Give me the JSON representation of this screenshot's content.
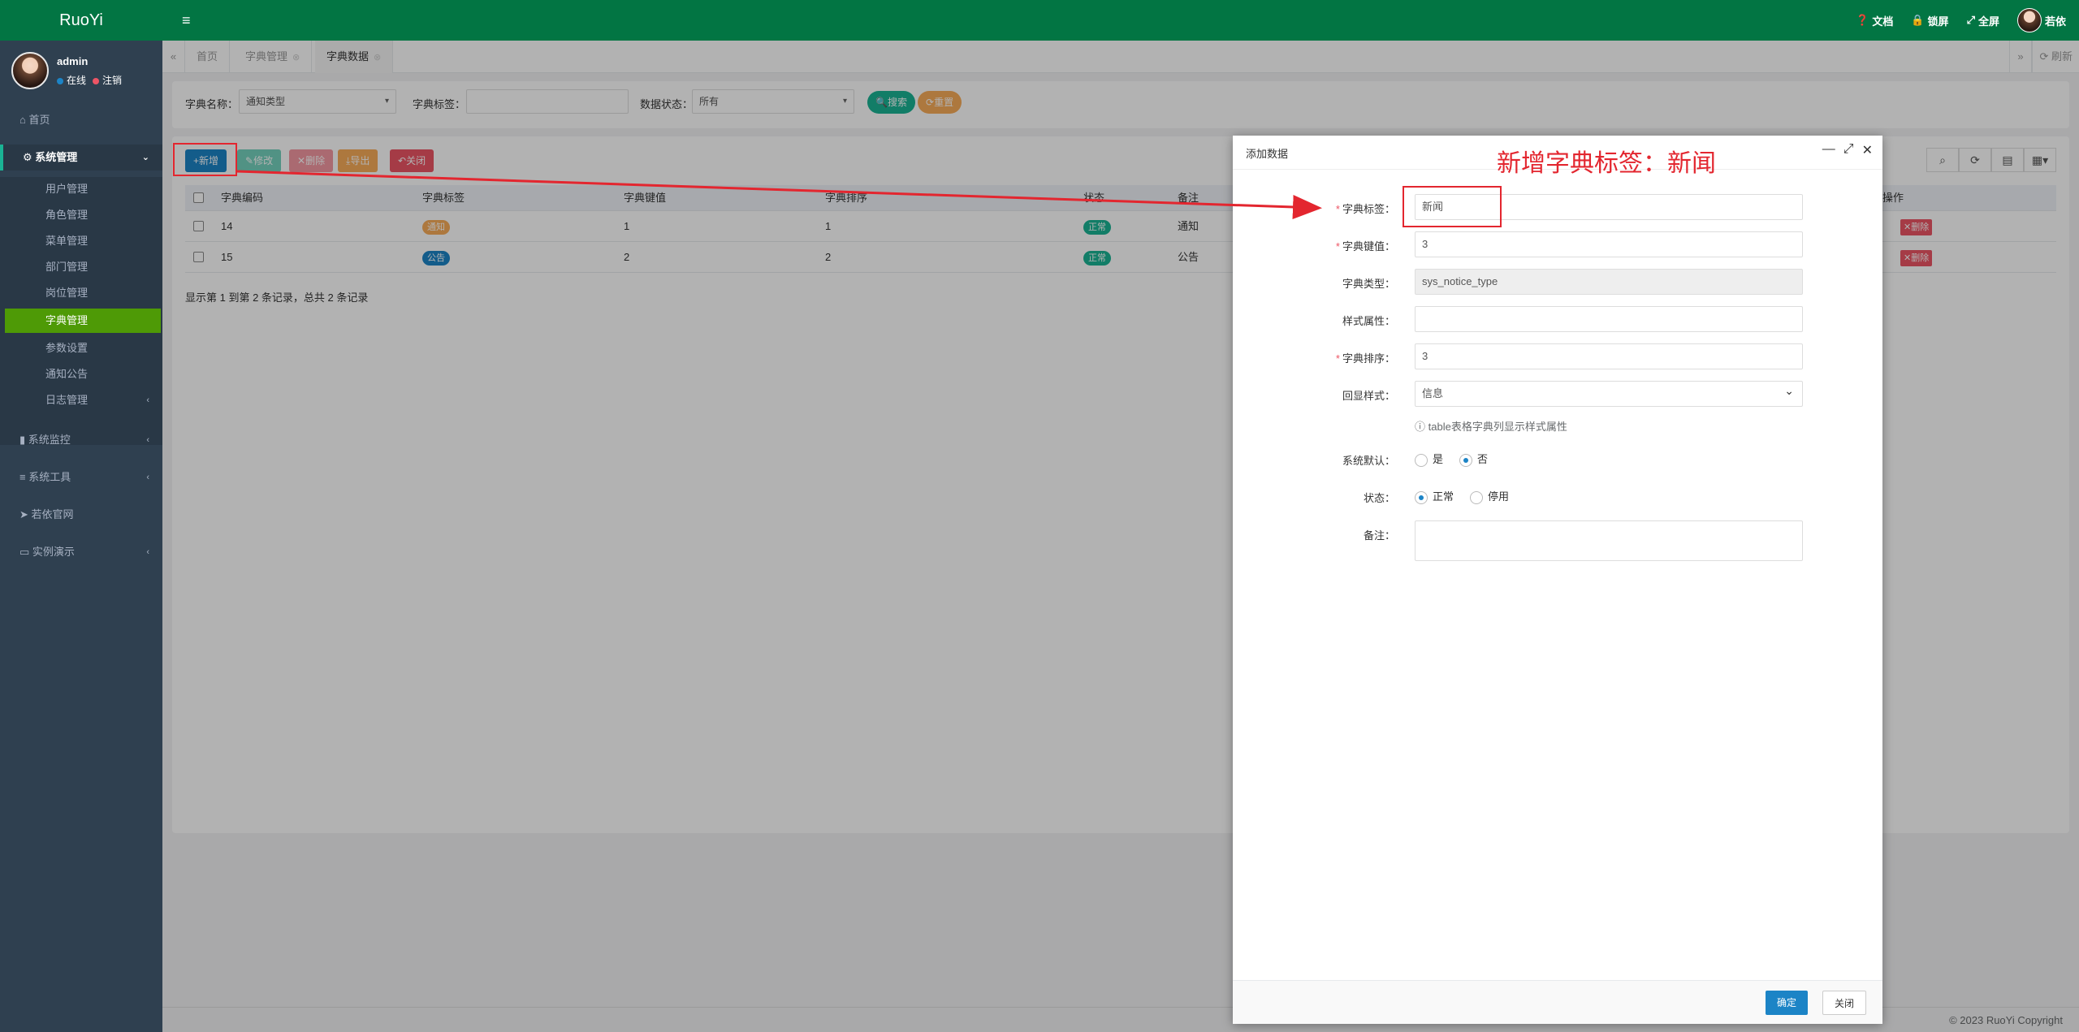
{
  "app": {
    "logo": "RuoYi"
  },
  "topbar": {
    "menu_icon": "bars-icon",
    "links": [
      {
        "icon": "question-circle-icon",
        "glyph": "?",
        "label": "文档"
      },
      {
        "icon": "lock-icon",
        "glyph": "🔒",
        "label": "锁屏"
      },
      {
        "icon": "fullscreen-icon",
        "glyph": "⤢",
        "label": "全屏"
      }
    ],
    "user_name": "若依"
  },
  "sidebar": {
    "user": {
      "name": "admin",
      "status_online": "在线",
      "status_logout": "注销",
      "online_color": "#1c84c6",
      "logout_color": "#ed5565"
    },
    "items": [
      {
        "icon": "home-icon",
        "label": "首页"
      },
      {
        "icon": "gear-icon",
        "label": "系统管理"
      },
      {
        "icon": "video-icon",
        "label": "系统监控"
      },
      {
        "icon": "bars-icon",
        "label": "系统工具"
      },
      {
        "icon": "location-arrow-icon",
        "label": "若依官网"
      },
      {
        "icon": "desktop-icon",
        "label": "实例演示"
      }
    ],
    "sub_items": [
      "用户管理",
      "角色管理",
      "菜单管理",
      "部门管理",
      "岗位管理",
      "字典管理",
      "参数设置",
      "通知公告",
      "日志管理"
    ],
    "active_sub": "字典管理"
  },
  "tabs": {
    "items": [
      {
        "label": "首页"
      },
      {
        "label": "字典管理"
      },
      {
        "label": "字典数据"
      }
    ],
    "refresh_label": "刷新"
  },
  "search": {
    "dict_name_label": "字典名称：",
    "dict_name_value": "通知类型",
    "dict_label_label": "字典标签：",
    "dict_label_value": "",
    "status_label": "数据状态：",
    "status_value": "所有",
    "search_btn": "搜索",
    "reset_btn": "重置"
  },
  "toolbar": {
    "add": "新增",
    "edit": "修改",
    "delete": "删除",
    "export": "导出",
    "close": "关闭"
  },
  "table": {
    "headers": [
      "字典编码",
      "字典标签",
      "字典键值",
      "字典排序",
      "状态",
      "备注",
      "操作"
    ],
    "rows": [
      {
        "code": "14",
        "label": "通知",
        "label_color": "#f8ac59",
        "value": "1",
        "sort": "1",
        "status": "正常",
        "remark": "通知",
        "ops": [
          "删除"
        ]
      },
      {
        "code": "15",
        "label": "公告",
        "label_color": "#1c84c6",
        "value": "2",
        "sort": "2",
        "status": "正常",
        "remark": "公告",
        "ops": [
          "删除"
        ]
      }
    ],
    "records": "显示第 1 到第 2 条记录，总共 2 条记录"
  },
  "modal": {
    "title": "添加数据",
    "fields": {
      "label": {
        "label": "字典标签：",
        "value": "新闻"
      },
      "value": {
        "label": "字典键值：",
        "value": "3"
      },
      "type": {
        "label": "字典类型：",
        "value": "sys_notice_type"
      },
      "css": {
        "label": "样式属性：",
        "value": ""
      },
      "sort": {
        "label": "字典排序：",
        "value": "3"
      },
      "list_class": {
        "label": "回显样式：",
        "value": "信息"
      },
      "hint": "table表格字典列显示样式属性",
      "is_default": {
        "label": "系统默认：",
        "opt_yes": "是",
        "opt_no": "否"
      },
      "status": {
        "label": "状态：",
        "opt_normal": "正常",
        "opt_disabled": "停用"
      },
      "remark": {
        "label": "备注：",
        "value": ""
      }
    },
    "confirm": "确定",
    "close": "关闭"
  },
  "annotation": {
    "text": "新增字典标签：新闻",
    "color": "#e3262f"
  },
  "footer": {
    "copyright": "© 2023 RuoYi Copyright"
  },
  "colors": {
    "topbar": "#027543",
    "sidebar": "#2f4050",
    "active_sub": "#4e9a06",
    "primary": "#1c84c6",
    "success": "#1ab394",
    "warning": "#f8ac59",
    "danger": "#ed5565"
  }
}
